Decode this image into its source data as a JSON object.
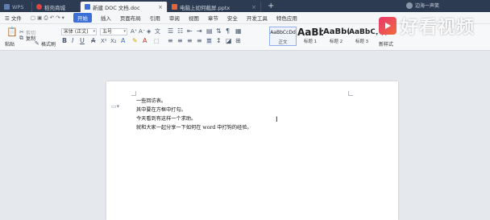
{
  "tabs": [
    {
      "label": "WPS",
      "active": false
    },
    {
      "label": "稻壳商城",
      "active": false
    },
    {
      "label": "新建 DOC 文档.doc",
      "active": true
    },
    {
      "label": "电脑上如何截屏.pptx",
      "active": false
    }
  ],
  "user_name": "边海一声笑",
  "menu": [
    "文件",
    "开始",
    "插入",
    "页面布局",
    "引用",
    "审阅",
    "视图",
    "章节",
    "安全",
    "开发工具",
    "特色应用"
  ],
  "menu_active": "开始",
  "ribbon": {
    "paste": "粘贴",
    "cut": "剪切",
    "copy": "复制",
    "format_painter": "格式刷",
    "font": "宋体 (正文)",
    "size": "五号",
    "styles": [
      {
        "preview": "AaBbCcDd",
        "name": "正文"
      },
      {
        "preview": "AaBb",
        "name": "标题 1"
      },
      {
        "preview": "AaBb(",
        "name": "标题 2"
      },
      {
        "preview": "AaBbC",
        "name": "标题 3"
      }
    ],
    "new_style": "新样式"
  },
  "document": {
    "lines": [
      "一些回访表。",
      "其中要在方框中打勾。",
      "今天看到有这样一个求助。",
      "就和大家一起分享一下如何在 word 中打钩的经验。"
    ]
  },
  "watermark": {
    "text": "好看视频"
  },
  "colors": {
    "titlebar": "#2d3b52",
    "accent": "#3d6fd8",
    "watermark_logo": "#e8356f"
  }
}
